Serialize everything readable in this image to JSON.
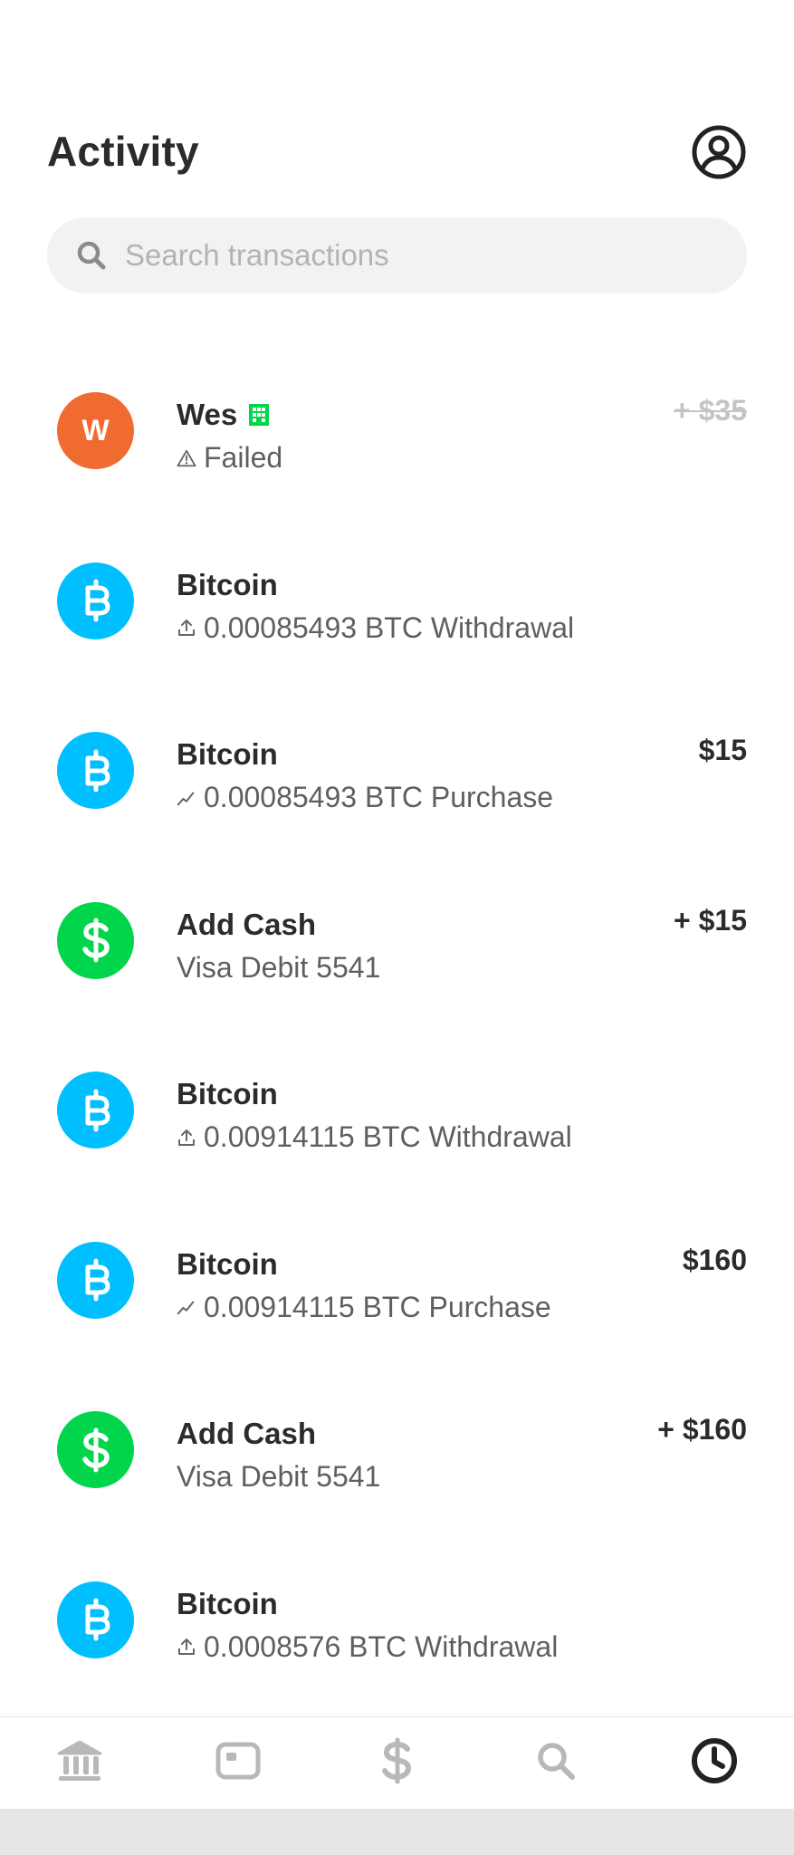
{
  "header": {
    "title": "Activity",
    "profile_icon": "user-circle-icon"
  },
  "search": {
    "placeholder": "Search transactions",
    "icon": "search-icon"
  },
  "colors": {
    "orange_avatar": "#F06B2F",
    "bitcoin_blue": "#00BFFF",
    "cash_green": "#00D54B",
    "business_badge": "#00D54B",
    "failed_amount": "#C4C4C4",
    "text_primary": "#2B2B2B",
    "text_secondary": "#5F5F5F"
  },
  "transactions": [
    {
      "avatar": "W",
      "avatar_type": "letter",
      "name": "Wes",
      "business_badge": true,
      "sub_icon": "warning-icon",
      "sub": "Failed",
      "amount": "+ $35",
      "failed": true
    },
    {
      "avatar_type": "bitcoin",
      "name": "Bitcoin",
      "sub_icon": "upload-icon",
      "sub": "0.00085493 BTC Withdrawal",
      "amount": ""
    },
    {
      "avatar_type": "bitcoin",
      "name": "Bitcoin",
      "sub_icon": "trend-icon",
      "sub": "0.00085493 BTC Purchase",
      "amount": "$15"
    },
    {
      "avatar_type": "cash",
      "name": "Add Cash",
      "sub_icon": "",
      "sub": "Visa Debit 5541",
      "amount": "+ $15"
    },
    {
      "avatar_type": "bitcoin",
      "name": "Bitcoin",
      "sub_icon": "upload-icon",
      "sub": "0.00914115 BTC Withdrawal",
      "amount": ""
    },
    {
      "avatar_type": "bitcoin",
      "name": "Bitcoin",
      "sub_icon": "trend-icon",
      "sub": "0.00914115 BTC Purchase",
      "amount": "$160"
    },
    {
      "avatar_type": "cash",
      "name": "Add Cash",
      "sub_icon": "",
      "sub": "Visa Debit 5541",
      "amount": "+ $160"
    },
    {
      "avatar_type": "bitcoin",
      "name": "Bitcoin",
      "sub_icon": "upload-icon",
      "sub": "0.0008576 BTC Withdrawal",
      "amount": ""
    }
  ],
  "bottom_nav": [
    {
      "icon": "bank-icon",
      "active": false
    },
    {
      "icon": "card-icon",
      "active": false
    },
    {
      "icon": "dollar-icon",
      "active": false
    },
    {
      "icon": "search-icon",
      "active": false
    },
    {
      "icon": "clock-icon",
      "active": true
    }
  ]
}
